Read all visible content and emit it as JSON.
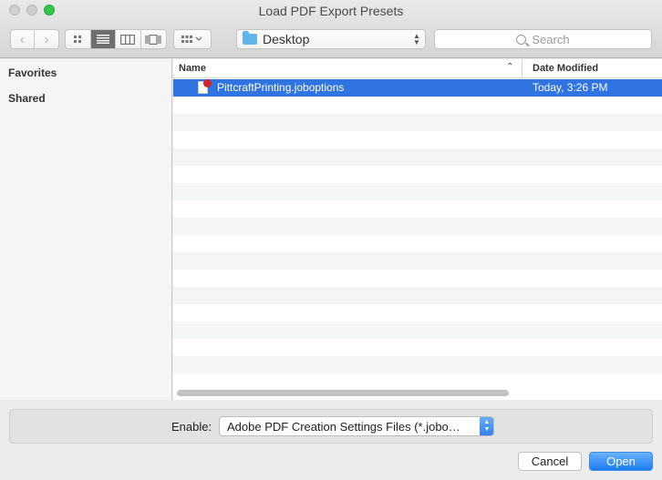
{
  "window": {
    "title": "Load PDF Export Presets"
  },
  "toolbar": {
    "back_icon": "chevron-left-icon",
    "forward_icon": "chevron-right-icon",
    "view_modes": [
      "icon-view-icon",
      "list-view-icon",
      "column-view-icon",
      "coverflow-view-icon"
    ],
    "active_view": "list-view-icon",
    "arrange_icon": "arrange-icon",
    "location": "Desktop",
    "search_placeholder": "Search"
  },
  "sidebar": {
    "sections": [
      "Favorites",
      "Shared"
    ]
  },
  "filelist": {
    "columns": {
      "name": "Name",
      "date_modified": "Date Modified"
    },
    "files": [
      {
        "name": "PittcraftPrinting.joboptions",
        "date": "Today, 3:26 PM",
        "selected": true
      }
    ]
  },
  "footer": {
    "enable_label": "Enable:",
    "format_value": "Adobe PDF Creation Settings Files (*.jobo…",
    "cancel_label": "Cancel",
    "open_label": "Open"
  },
  "colors": {
    "selection": "#2f74e0",
    "primary_button": "#1d7cf2",
    "zoom_button": "#34c84a"
  }
}
